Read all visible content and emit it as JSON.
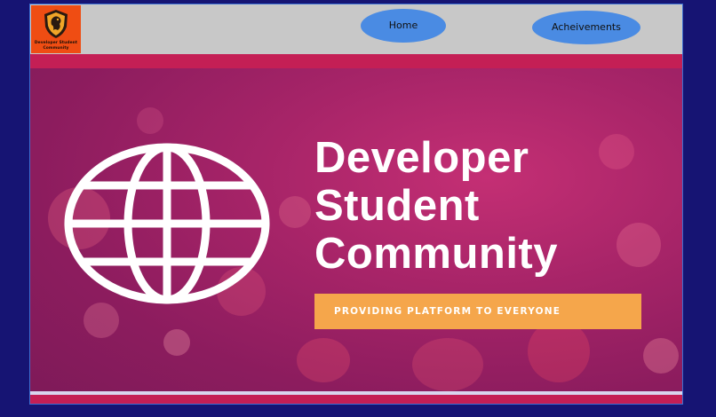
{
  "logo": {
    "line1": "Developer Student",
    "line2": "Community",
    "icon": "dragon-shield-icon"
  },
  "nav": {
    "home_label": "Home",
    "achievements_label": "Acheivements"
  },
  "hero": {
    "title_line1": "Developer",
    "title_line2": "Student",
    "title_line3": "Community",
    "tagline": "PROVIDING PLATFORM TO EVERYONE",
    "icon": "globe-icon"
  },
  "colors": {
    "page_bg": "#161473",
    "navbar_bg": "#c8c8c8",
    "nav_button": "#4a8be3",
    "logo_bg": "#ef4d13",
    "hero_bg": "#a72468",
    "hero_band": "#c41f55",
    "tagline_bg": "#f5a64b"
  }
}
